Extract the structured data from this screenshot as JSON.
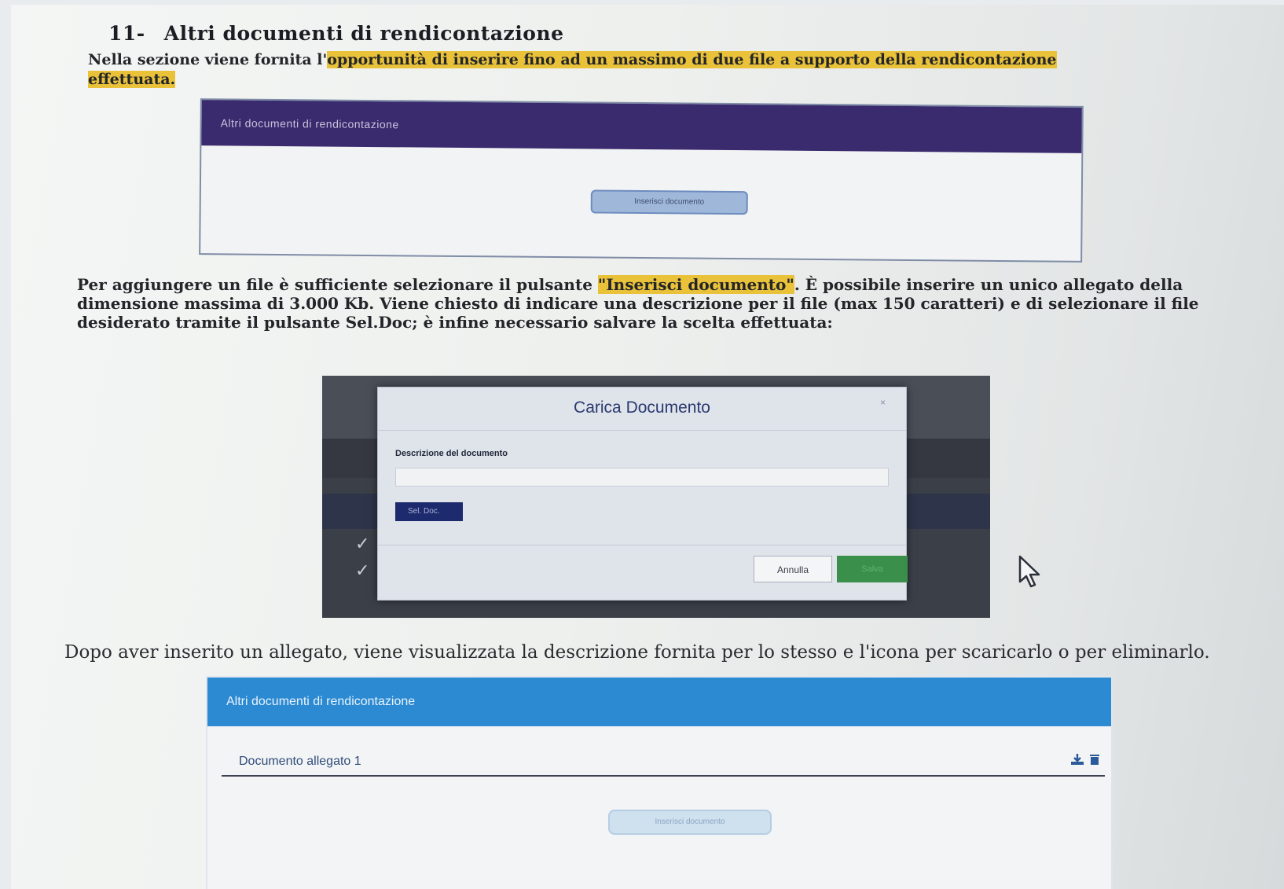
{
  "section": {
    "number": "11-",
    "title": "Altri documenti di rendicontazione"
  },
  "intro": {
    "plain": "Nella sezione viene fornita l'",
    "highlight": "opportunità di inserire fino ad un massimo di due file a supporto della rendicontazione effettuata."
  },
  "panel_empty": {
    "header": "Altri documenti di rendicontazione",
    "insert_button": "Inserisci documento"
  },
  "para1": {
    "before": "Per aggiungere un file è sufficiente selezionare il pulsante ",
    "highlight": "\"Inserisci documento\"",
    "after": ". È possibile inserire un unico allegato della dimensione massima di 3.000 Kb. Viene chiesto di indicare una descrizione per il file (max 150 caratteri) e di selezionare il file desiderato tramite il pulsante Sel.Doc; è infine necessario salvare la scelta effettuata:"
  },
  "modal": {
    "title": "Carica Documento",
    "close": "×",
    "description_label": "Descrizione del documento",
    "description_value": "",
    "seldoc_button": "Sel. Doc.",
    "cancel_button": "Annulla",
    "save_button": "Salva"
  },
  "para2": "Dopo aver inserito un allegato, viene visualizzata la descrizione fornita per lo stesso e l'icona per scaricarlo o per eliminarlo.",
  "panel_filled": {
    "header": "Altri documenti di rendicontazione",
    "attachment_label": "Documento allegato 1",
    "insert_button": "Inserisci documento",
    "icons": [
      "download-icon",
      "trash-icon"
    ]
  },
  "colors": {
    "highlight": "#e9c23a",
    "panel_header_purple": "#3a2a6e",
    "panel_header_blue": "#2b8ad2",
    "save_green": "#3a8f4a"
  }
}
